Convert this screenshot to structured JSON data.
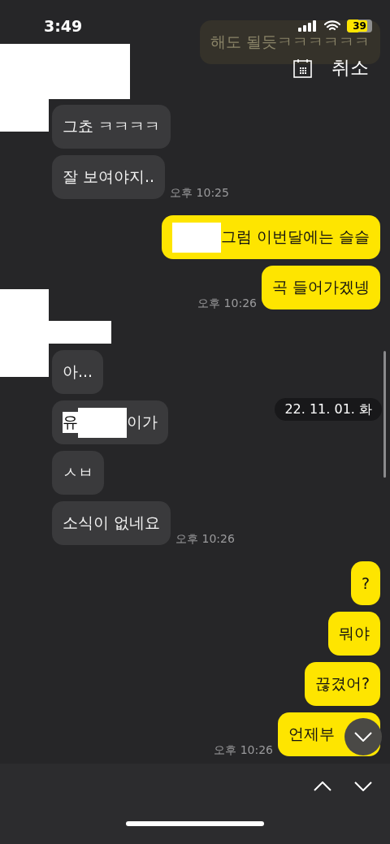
{
  "status_bar": {
    "time": "3:49",
    "battery": "39"
  },
  "header": {
    "cancel": "취소"
  },
  "date_label": "22. 11. 01. 화",
  "messages": [
    {
      "kind": "sent",
      "faded": true,
      "redacted_sender": false,
      "parts": [
        {
          "kind": "text",
          "text": "해도 될듯ㅋㅋㅋㅋㅋㅋ"
        }
      ]
    },
    {
      "kind": "received",
      "faded": false,
      "redacted_sender": true,
      "parts": [
        {
          "kind": "text",
          "text": "그쵸 ㅋㅋㅋㅋ"
        }
      ]
    },
    {
      "kind": "received",
      "faded": false,
      "redacted_sender": false,
      "parts": [
        {
          "kind": "text",
          "text": "잘 보여야지.."
        }
      ],
      "time": "오후 10:25"
    },
    {
      "kind": "sent",
      "faded": false,
      "redacted_sender": false,
      "parts": [
        {
          "kind": "redacted"
        },
        {
          "kind": "text",
          "text": "그럼 이번달에는 슬슬"
        }
      ]
    },
    {
      "kind": "sent",
      "faded": false,
      "redacted_sender": false,
      "parts": [
        {
          "kind": "text",
          "text": "곡 들어가겠넹"
        }
      ],
      "time": "오후 10:26"
    },
    {
      "kind": "received",
      "faded": false,
      "redacted_sender": true,
      "parts": [
        {
          "kind": "text",
          "text": "아..."
        }
      ]
    },
    {
      "kind": "received",
      "faded": false,
      "redacted_sender": false,
      "parts": [
        {
          "kind": "highlight",
          "text": "유"
        },
        {
          "kind": "redacted"
        },
        {
          "kind": "text",
          "text": "이가"
        }
      ]
    },
    {
      "kind": "received",
      "faded": false,
      "redacted_sender": false,
      "parts": [
        {
          "kind": "text",
          "text": "ㅅㅂ"
        }
      ]
    },
    {
      "kind": "received",
      "faded": false,
      "redacted_sender": false,
      "parts": [
        {
          "kind": "text",
          "text": "소식이 없네요"
        }
      ],
      "time": "오후 10:26"
    },
    {
      "kind": "sent",
      "faded": false,
      "redacted_sender": false,
      "parts": [
        {
          "kind": "text",
          "text": "?"
        }
      ]
    },
    {
      "kind": "sent",
      "faded": false,
      "redacted_sender": false,
      "parts": [
        {
          "kind": "text",
          "text": "뭐야"
        }
      ]
    },
    {
      "kind": "sent",
      "faded": false,
      "redacted_sender": false,
      "parts": [
        {
          "kind": "text",
          "text": "끊겼어?"
        }
      ]
    },
    {
      "kind": "sent",
      "faded": false,
      "redacted_sender": false,
      "parts": [
        {
          "kind": "text",
          "text": "언제부"
        }
      ],
      "time": "오후 10:26"
    }
  ]
}
